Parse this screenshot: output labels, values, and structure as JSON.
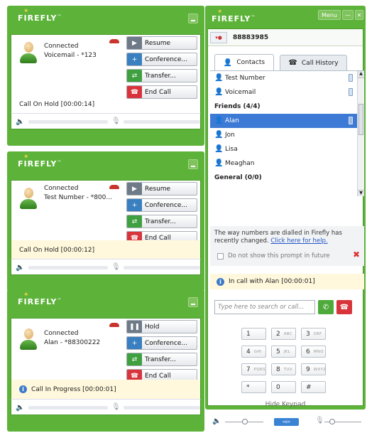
{
  "brand": {
    "name": "FIREFLY",
    "tm": "™",
    "accent": "#5db33a"
  },
  "call_windows": [
    {
      "status": "Connected",
      "caller": "Voicemail - *123",
      "buttons": [
        "Resume",
        "Conference...",
        "Transfer...",
        "End Call"
      ],
      "call_status": "Call On Hold [00:00:14]"
    },
    {
      "status": "Connected",
      "caller": "Test Number - *800...",
      "buttons": [
        "Resume",
        "Conference...",
        "Transfer...",
        "End Call"
      ],
      "call_status": "Call On Hold [00:00:12]"
    },
    {
      "status": "Connected",
      "caller": "Alan - *88300222",
      "buttons": [
        "Hold",
        "Conference...",
        "Transfer...",
        "End Call"
      ],
      "call_status": "Call In Progress [00:00:01]"
    }
  ],
  "main": {
    "menu_label": "Menu",
    "number": "88883985",
    "tabs": [
      "Contacts",
      "Call History"
    ],
    "contacts": [
      {
        "name": "Test Number",
        "type": "contact"
      },
      {
        "name": "Voicemail",
        "type": "contact"
      },
      {
        "name": "Friends (4/4)",
        "type": "group"
      },
      {
        "name": "Alan",
        "type": "contact",
        "selected": true
      },
      {
        "name": "Jon",
        "type": "contact"
      },
      {
        "name": "Lisa",
        "type": "contact"
      },
      {
        "name": "Meaghan",
        "type": "contact"
      },
      {
        "name": "General (0/0)",
        "type": "group"
      }
    ],
    "notice": {
      "text": "The way numbers are dialled in Firefly has recently changed.",
      "link": "Click here for help.",
      "checkbox_label": "Do not show this prompt in future"
    },
    "in_call": "In call with Alan [00:00:01]",
    "search_placeholder": "Type here to search or call...",
    "keypad": [
      {
        "d": "1",
        "s": ""
      },
      {
        "d": "2",
        "s": "ABC"
      },
      {
        "d": "3",
        "s": "DEF"
      },
      {
        "d": "4",
        "s": "GHI"
      },
      {
        "d": "5",
        "s": "JKL"
      },
      {
        "d": "6",
        "s": "MNO"
      },
      {
        "d": "7",
        "s": "PQRS"
      },
      {
        "d": "8",
        "s": "TUV"
      },
      {
        "d": "9",
        "s": "WXYZ"
      },
      {
        "d": "*",
        "s": ""
      },
      {
        "d": "0",
        "s": ""
      },
      {
        "d": "#",
        "s": ""
      }
    ],
    "hide_keypad": "Hide Keypad"
  }
}
